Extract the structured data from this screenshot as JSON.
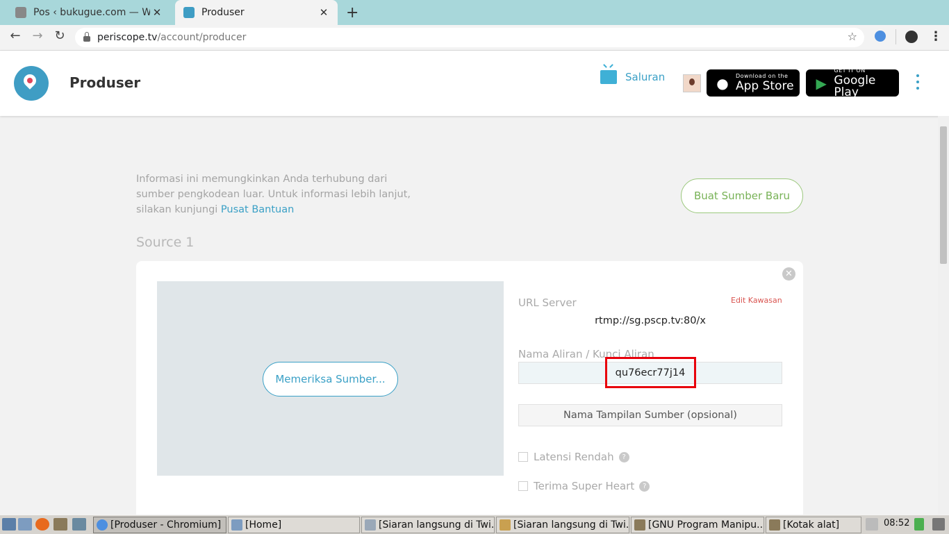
{
  "browser": {
    "tabs": [
      {
        "title": "Pos ‹ bukugue.com — Wo",
        "active": false
      },
      {
        "title": "Produser",
        "active": true
      }
    ],
    "url_host": "periscope.tv",
    "url_path": "/account/producer"
  },
  "header": {
    "title": "Produser",
    "channels_label": "Saluran",
    "app_store": {
      "small": "Download on the",
      "big": "App Store"
    },
    "google_play": {
      "small": "GET IT ON",
      "big": "Google Play"
    }
  },
  "content": {
    "info_text": "Informasi ini memungkinkan Anda terhubung dari sumber pengkodean luar. Untuk informasi lebih lanjut, silakan kunjungi ",
    "help_link": "Pusat Bantuan",
    "new_source_button": "Buat Sumber Baru",
    "source_title": "Source 1",
    "check_source_button": "Memeriksa Sumber...",
    "server_url_label": "URL Server",
    "edit_region_link": "Edit Kawasan",
    "server_url": "rtmp://sg.pscp.tv:80/x",
    "stream_key_label": "Nama Aliran / Kunci Aliran",
    "stream_key": "qu76ecr77j14",
    "display_name_placeholder": "Nama Tampilan Sumber (opsional)",
    "options": [
      {
        "label": "Latensi Rendah",
        "checked": false
      },
      {
        "label": "Terima Super Heart",
        "checked": false
      }
    ],
    "highlight_color": "#e8000b"
  },
  "taskbar": {
    "tasks": [
      "[Produser - Chromium]",
      "[Home]",
      "[Siaran langsung di Twi...",
      "[Siaran langsung di Twi...",
      "[GNU Program Manipu...",
      "[Kotak alat]"
    ],
    "time": "08:52"
  }
}
